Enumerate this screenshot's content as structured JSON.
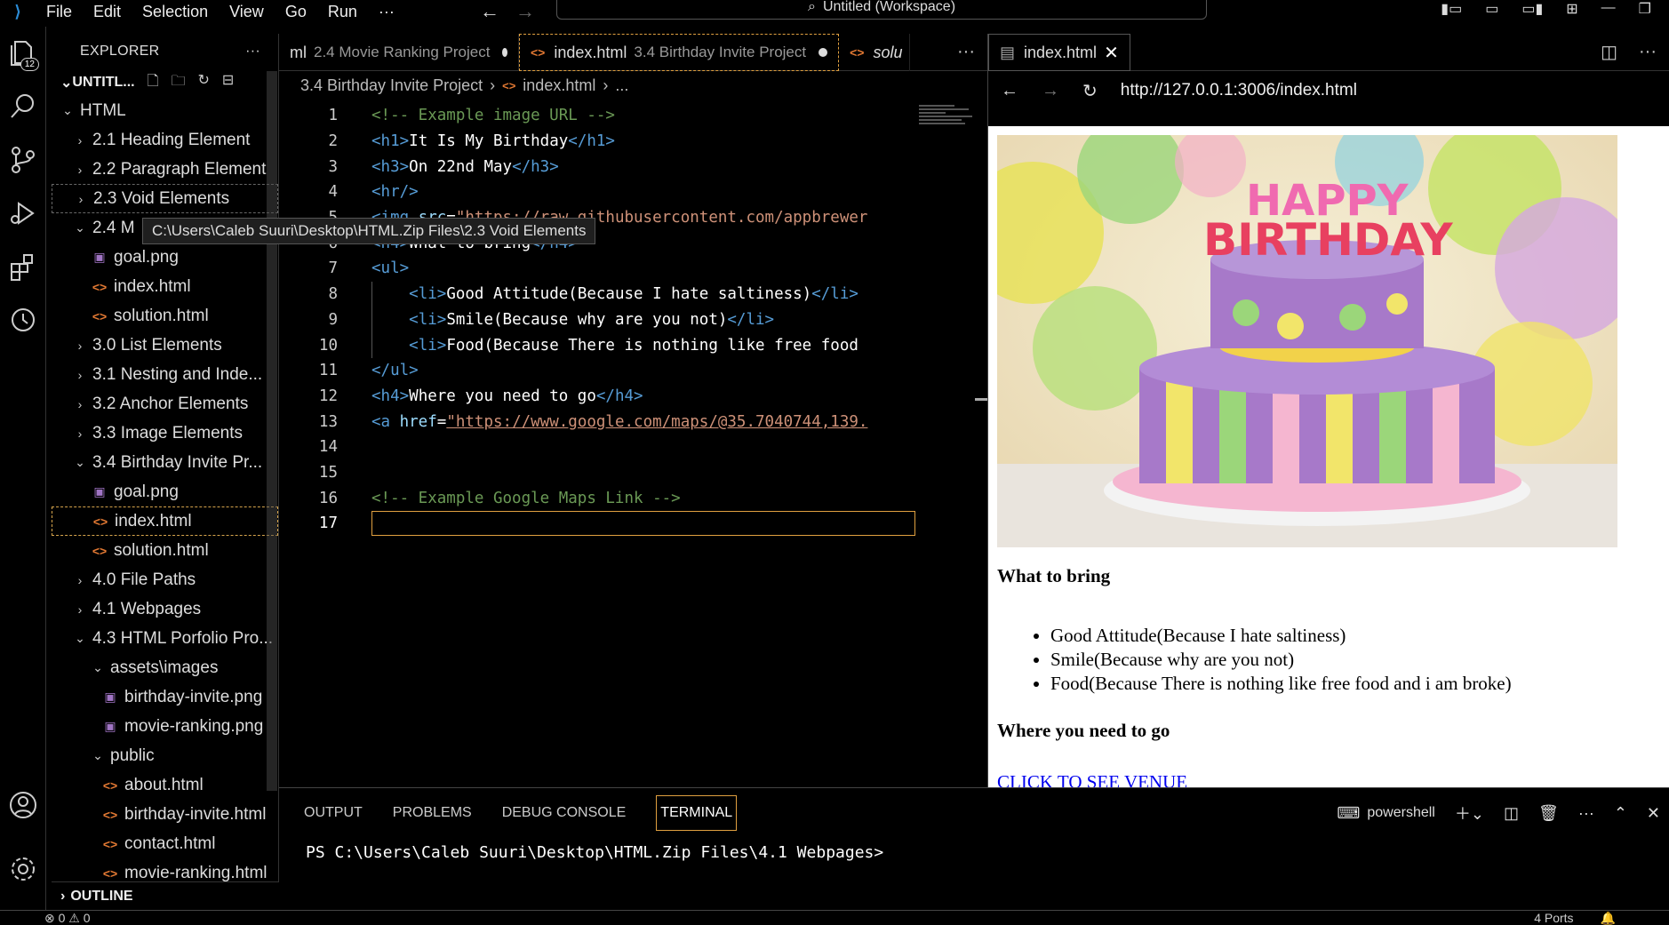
{
  "titlebar": {
    "menu": [
      "File",
      "Edit",
      "Selection",
      "View",
      "Go",
      "Run",
      "···"
    ],
    "command_center": "Untitled (Workspace)"
  },
  "activity": {
    "badge": "12"
  },
  "sidebar": {
    "title": "EXPLORER",
    "more": "···",
    "workspace": "UNTITL...",
    "outline": "OUTLINE",
    "tooltip": "C:\\Users\\Caleb Suuri\\Desktop\\HTML.Zip Files\\2.3 Void Elements",
    "items": [
      {
        "label": "HTML",
        "kind": "folder-open",
        "depth": 1
      },
      {
        "label": "2.1 Heading Element",
        "kind": "folder",
        "depth": 2
      },
      {
        "label": "2.2 Paragraph Element",
        "kind": "folder",
        "depth": 2
      },
      {
        "label": "2.3 Void Elements",
        "kind": "folder",
        "depth": 2,
        "state": "hover"
      },
      {
        "label": "2.4 M",
        "kind": "folder-open",
        "depth": 2
      },
      {
        "label": "goal.png",
        "kind": "image",
        "depth": 3
      },
      {
        "label": "index.html",
        "kind": "html",
        "depth": 3
      },
      {
        "label": "solution.html",
        "kind": "html",
        "depth": 3
      },
      {
        "label": "3.0 List Elements",
        "kind": "folder",
        "depth": 2
      },
      {
        "label": "3.1 Nesting and Inde...",
        "kind": "folder",
        "depth": 2
      },
      {
        "label": "3.2 Anchor Elements",
        "kind": "folder",
        "depth": 2
      },
      {
        "label": "3.3 Image Elements",
        "kind": "folder",
        "depth": 2
      },
      {
        "label": "3.4 Birthday Invite Pr...",
        "kind": "folder-open",
        "depth": 2
      },
      {
        "label": "goal.png",
        "kind": "image",
        "depth": 3
      },
      {
        "label": "index.html",
        "kind": "html",
        "depth": 3,
        "state": "active"
      },
      {
        "label": "solution.html",
        "kind": "html",
        "depth": 3
      },
      {
        "label": "4.0 File Paths",
        "kind": "folder",
        "depth": 2
      },
      {
        "label": "4.1 Webpages",
        "kind": "folder",
        "depth": 2
      },
      {
        "label": "4.3 HTML Porfolio Pro...",
        "kind": "folder-open",
        "depth": 2
      },
      {
        "label": "assets\\images",
        "kind": "folder-open",
        "depth": 3
      },
      {
        "label": "birthday-invite.png",
        "kind": "image",
        "depth": 4
      },
      {
        "label": "movie-ranking.png",
        "kind": "image",
        "depth": 4
      },
      {
        "label": "public",
        "kind": "folder-open",
        "depth": 3
      },
      {
        "label": "about.html",
        "kind": "html",
        "depth": 4
      },
      {
        "label": "birthday-invite.html",
        "kind": "html",
        "depth": 4
      },
      {
        "label": "contact.html",
        "kind": "html",
        "depth": 4
      },
      {
        "label": "movie-ranking.html",
        "kind": "html",
        "depth": 4
      }
    ]
  },
  "editor": {
    "tabs": [
      {
        "name": "ml",
        "desc": "2.4 Movie Ranking Project",
        "dirty": true
      },
      {
        "name": "index.html",
        "desc": "3.4 Birthday Invite Project",
        "dirty": true,
        "active": true
      },
      {
        "name": "solu",
        "desc": "",
        "dirty": false
      }
    ],
    "tabs_more": "···",
    "breadcrumb": [
      "3.4 Birthday Invite Project",
      "index.html",
      "..."
    ],
    "lines": [
      {
        "n": "1",
        "parts": [
          [
            "cm",
            "<!-- Example image URL -->"
          ]
        ]
      },
      {
        "n": "2",
        "parts": [
          [
            "tg",
            "<h1>"
          ],
          [
            "tx",
            "It Is My Birthday"
          ],
          [
            "tg",
            "</h1>"
          ]
        ]
      },
      {
        "n": "3",
        "parts": [
          [
            "tg",
            "<h3>"
          ],
          [
            "tx",
            "On 22nd May"
          ],
          [
            "tg",
            "</h3>"
          ]
        ]
      },
      {
        "n": "4",
        "parts": [
          [
            "tg",
            "<hr/>"
          ]
        ]
      },
      {
        "n": "5",
        "parts": [
          [
            "tg",
            "<img "
          ],
          [
            "at",
            "src"
          ],
          [
            "tx",
            "="
          ],
          [
            "sv",
            "\"https://raw.githubusercontent.com/appbrewer"
          ]
        ]
      },
      {
        "n": "6",
        "parts": [
          [
            "tg",
            "<h4>"
          ],
          [
            "tx",
            "What to bring"
          ],
          [
            "tg",
            "</h4>"
          ]
        ]
      },
      {
        "n": "7",
        "parts": [
          [
            "tg",
            "<ul>"
          ]
        ]
      },
      {
        "n": "8",
        "parts": [
          [
            "tx",
            "    "
          ],
          [
            "tg",
            "<li>"
          ],
          [
            "tx",
            "Good Attitude(Because I hate saltiness)"
          ],
          [
            "tg",
            "</li>"
          ]
        ]
      },
      {
        "n": "9",
        "parts": [
          [
            "tx",
            "    "
          ],
          [
            "tg",
            "<li>"
          ],
          [
            "tx",
            "Smile(Because why are you not)"
          ],
          [
            "tg",
            "</li>"
          ]
        ]
      },
      {
        "n": "10",
        "parts": [
          [
            "tx",
            "    "
          ],
          [
            "tg",
            "<li>"
          ],
          [
            "tx",
            "Food(Because There is nothing like free food"
          ]
        ]
      },
      {
        "n": "11",
        "parts": [
          [
            "tg",
            "</ul>"
          ]
        ]
      },
      {
        "n": "12",
        "parts": [
          [
            "tg",
            "<h4>"
          ],
          [
            "tx",
            "Where you need to go"
          ],
          [
            "tg",
            "</h4>"
          ]
        ]
      },
      {
        "n": "13",
        "parts": [
          [
            "tg",
            "<a "
          ],
          [
            "at",
            "href"
          ],
          [
            "tx",
            "="
          ],
          [
            "url",
            "\"https://www.google.com/maps/@35.7040744,139."
          ]
        ]
      },
      {
        "n": "14",
        "parts": []
      },
      {
        "n": "15",
        "parts": []
      },
      {
        "n": "16",
        "parts": [
          [
            "cm",
            "<!-- Example Google Maps Link -->"
          ]
        ]
      },
      {
        "n": "17",
        "parts": [],
        "current": true
      }
    ]
  },
  "preview": {
    "tab": "index.html",
    "url": "http://127.0.0.1:3006/index.html",
    "cake_text": [
      "HAPPY",
      "BIRTHDAY"
    ],
    "h4_bring": "What to bring",
    "list": [
      "Good Attitude(Because I hate saltiness)",
      "Smile(Because why are you not)",
      "Food(Because There is nothing like free food and i am broke)"
    ],
    "h4_go": "Where you need to go",
    "link": "CLICK TO SEE VENUE"
  },
  "panel": {
    "tabs": [
      "OUTPUT",
      "PROBLEMS",
      "DEBUG CONSOLE",
      "TERMINAL"
    ],
    "active": "TERMINAL",
    "shell": "powershell",
    "prompt": "PS C:\\Users\\Caleb Suuri\\Desktop\\HTML.Zip Files\\4.1 Webpages>"
  },
  "status": {
    "left": "⊗ 0 ⚠ 0",
    "ports": "4 Ports"
  }
}
